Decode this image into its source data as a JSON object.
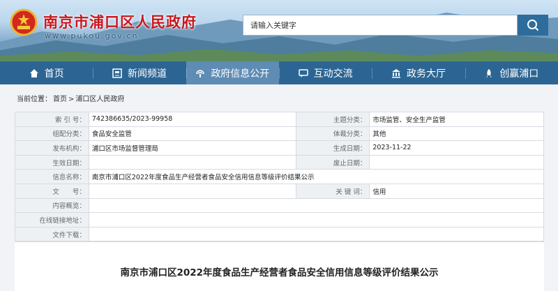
{
  "header": {
    "site_title": "南京市浦口区人民政府",
    "site_domain": "www.pukou.gov.cn",
    "search_placeholder": "请输入关键字"
  },
  "nav": [
    {
      "label": "首页",
      "icon": "home-icon",
      "active": false
    },
    {
      "label": "新闻频道",
      "icon": "news-icon",
      "active": false
    },
    {
      "label": "政府信息公开",
      "icon": "broadcast-icon",
      "active": true
    },
    {
      "label": "互动交流",
      "icon": "chat-icon",
      "active": false
    },
    {
      "label": "政务大厅",
      "icon": "hall-icon",
      "active": false
    },
    {
      "label": "创赢浦口",
      "icon": "rocket-icon",
      "active": false
    }
  ],
  "breadcrumb": {
    "prefix": "当前位置：",
    "items": [
      "首页",
      ">",
      "浦口区人民政府"
    ]
  },
  "info": {
    "index_label": "索 引 号：",
    "index_value": "742386635/2023-99958",
    "topic_label": "主题分类：",
    "topic_value": "市场监管、安全生产监管",
    "group_label": "组配分类：",
    "group_value": "食品安全监管",
    "genre_label": "体裁分类：",
    "genre_value": "其他",
    "org_label": "发布机构：",
    "org_value": "浦口区市场监督管理局",
    "created_label": "生成日期：",
    "created_value": "2023-11-22",
    "effective_label": "生效日期：",
    "effective_value": "",
    "repeal_label": "废止日期：",
    "repeal_value": "",
    "name_label": "信息名称：",
    "name_value": "南京市浦口区2022年度食品生产经营者食品安全信用信息等级评价结果公示",
    "doc_label": "文　　号：",
    "doc_value": "",
    "keyword_label": "关 键 词：",
    "keyword_value": "信用",
    "preview_label": "内容概览：",
    "preview_value": "",
    "link_label": "在线链接地址：",
    "link_value": "",
    "download_label": "文件下载：",
    "download_value": ""
  },
  "article": {
    "title": "南京市浦口区2022年度食品生产经营者食品安全信用信息等级评价结果公示"
  },
  "colors": {
    "nav_bg": "#2c6593",
    "nav_active": "#5e8cb4",
    "title_red": "#c8161d"
  }
}
